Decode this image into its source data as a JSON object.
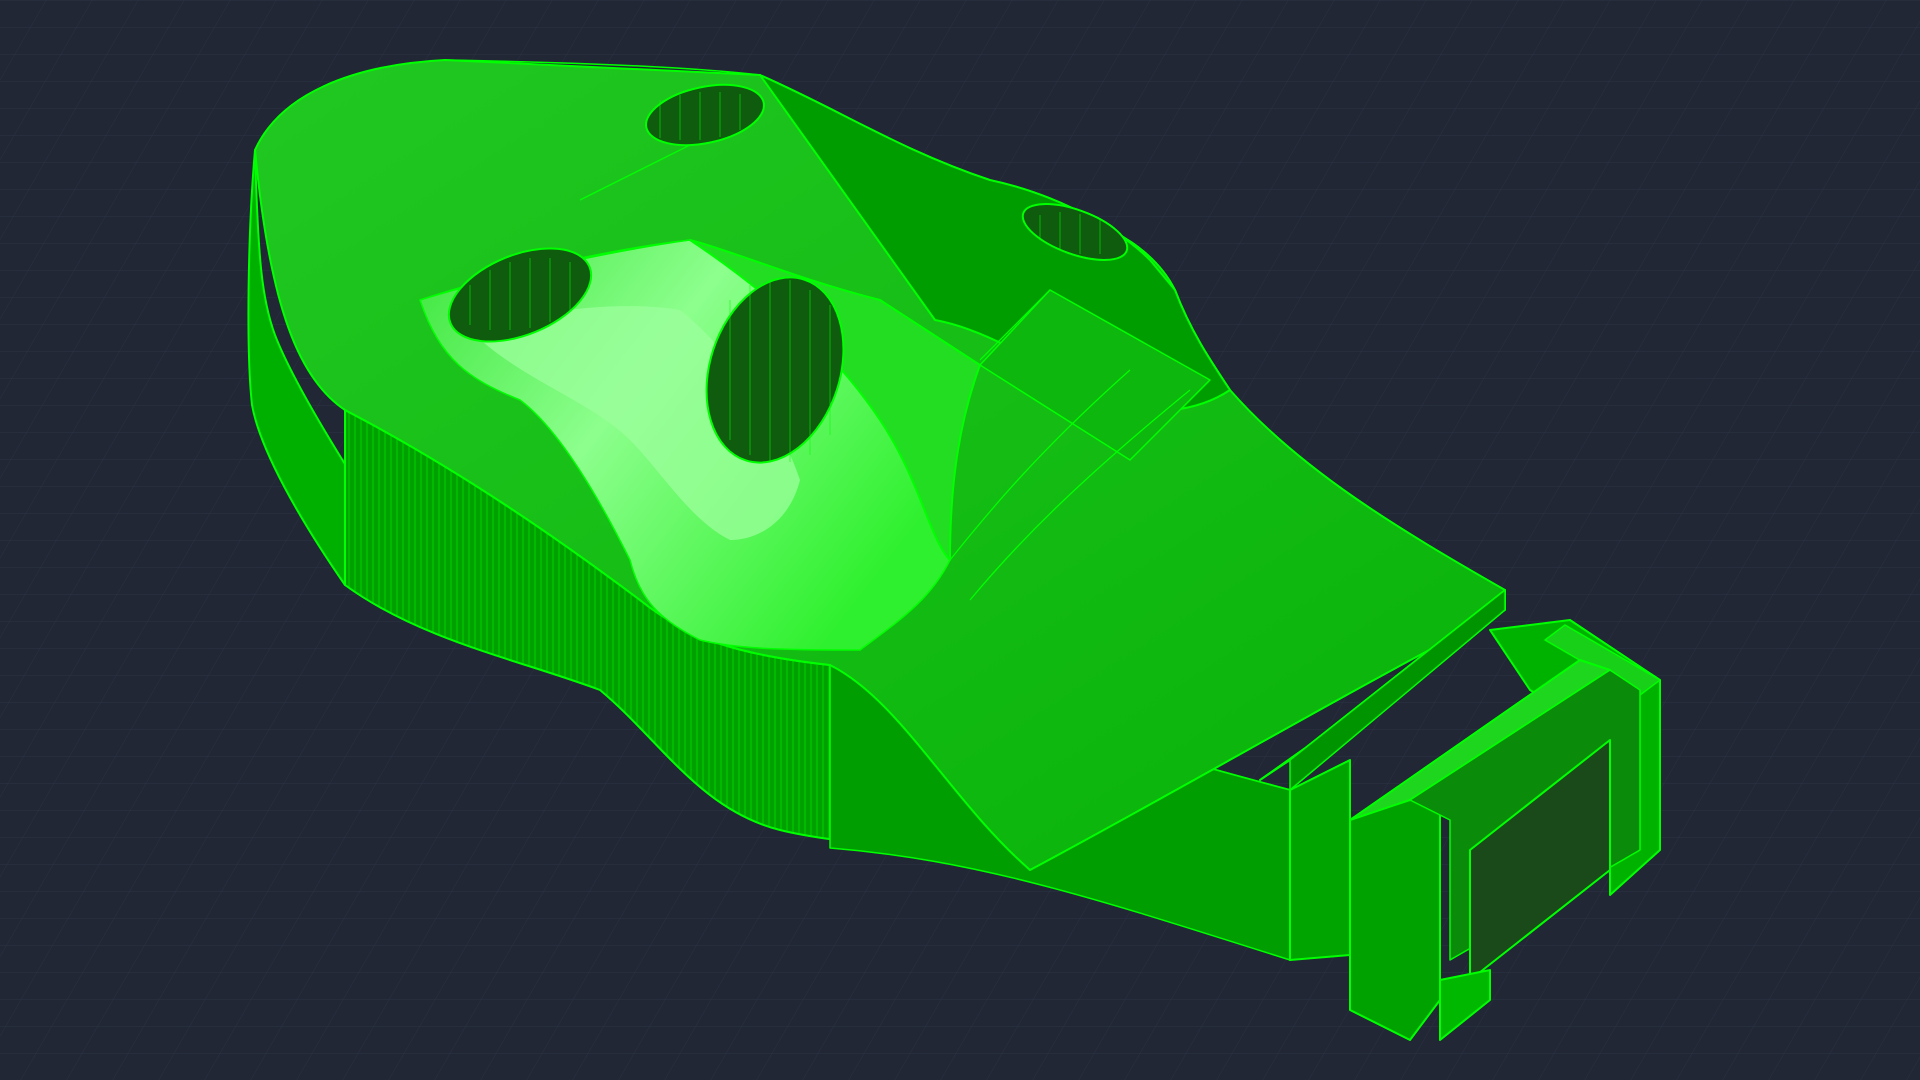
{
  "viewport": {
    "background_color": "#212735",
    "grid_color": "#2b3242",
    "grid_visible": true,
    "projection": "isometric"
  },
  "model": {
    "shading": "wireframe-shaded",
    "colors": {
      "base": "#00a800",
      "top": "#1ec81e",
      "highlight": "#8cff8c",
      "bright": "#3dff3d",
      "dark_face": "#007f00",
      "side": "#00b400",
      "edge": "#00ff00"
    }
  }
}
